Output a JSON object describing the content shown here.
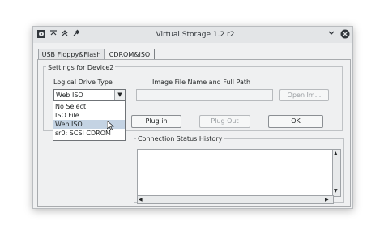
{
  "window": {
    "title": "Virtual Storage 1.2 r2",
    "icons": [
      "app-icon",
      "keep-below-icon",
      "keep-above-icon",
      "pin-icon",
      "minimize-icon",
      "close-icon"
    ]
  },
  "tabs": [
    {
      "label": "USB Floppy&Flash",
      "active": false
    },
    {
      "label": "CDROM&ISO",
      "active": true
    }
  ],
  "settings": {
    "group_title": "Settings for Device2",
    "drive_type_label": "Logical Drive Type",
    "drive_type_value": "Web ISO",
    "options": [
      "No Select",
      "ISO File",
      "Web ISO",
      "sr0: SCSI CDROM"
    ],
    "selected_option_index": 2,
    "image_label": "Image File Name and Full Path",
    "image_path_value": "",
    "open_button": "Open Im..."
  },
  "buttons": {
    "plug_in": "Plug in",
    "plug_out": "Plug Out",
    "ok": "OK"
  },
  "history": {
    "title": "Connection Status History",
    "content": ""
  },
  "colors": {
    "window_bg": "#eff0f1",
    "selection": "#c4d3e3",
    "titlebar": "#e3e5e7"
  }
}
